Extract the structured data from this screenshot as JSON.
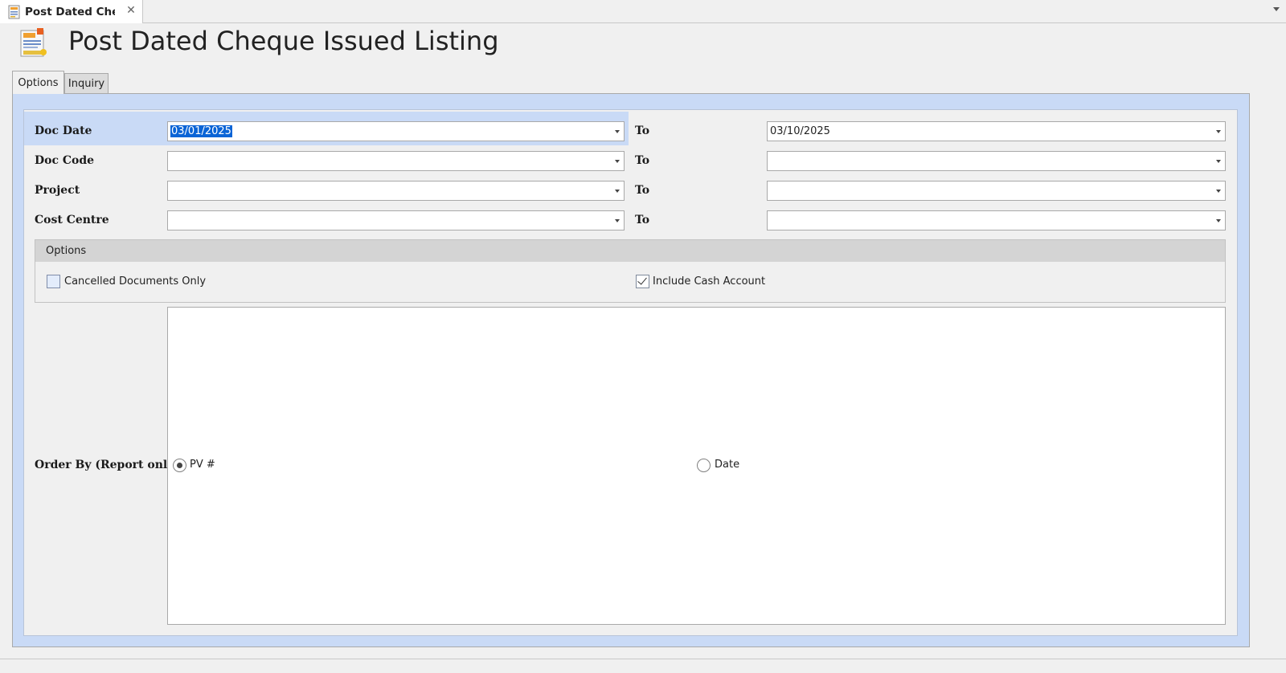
{
  "doc_tab": {
    "title": "Post Dated Cheque Issued Listing",
    "title_visible": "Post Dated Chec"
  },
  "header": {
    "title": "Post Dated Cheque Issued Listing"
  },
  "tabs": [
    {
      "label": "Options",
      "active": true
    },
    {
      "label": "Inquiry",
      "active": false
    }
  ],
  "filters": [
    {
      "label": "Doc Date",
      "from": "03/01/2025",
      "to_label": "To",
      "to": "03/10/2025"
    },
    {
      "label": "Doc Code",
      "from": "",
      "to_label": "To",
      "to": ""
    },
    {
      "label": "Project",
      "from": "",
      "to_label": "To",
      "to": ""
    },
    {
      "label": "Cost Centre",
      "from": "",
      "to_label": "To",
      "to": ""
    }
  ],
  "options": {
    "header": "Options",
    "cancelled_only": {
      "label": "Cancelled Documents Only",
      "checked": false
    },
    "include_cash": {
      "label": "Include Cash Account",
      "checked": true
    }
  },
  "order_by": {
    "label": "Order By (Report only)",
    "choices": [
      {
        "label": "PV #",
        "selected": true
      },
      {
        "label": "Date",
        "selected": false
      }
    ]
  },
  "colors": {
    "accent_panel": "#c9daf6",
    "selection": "#0a64d6"
  }
}
